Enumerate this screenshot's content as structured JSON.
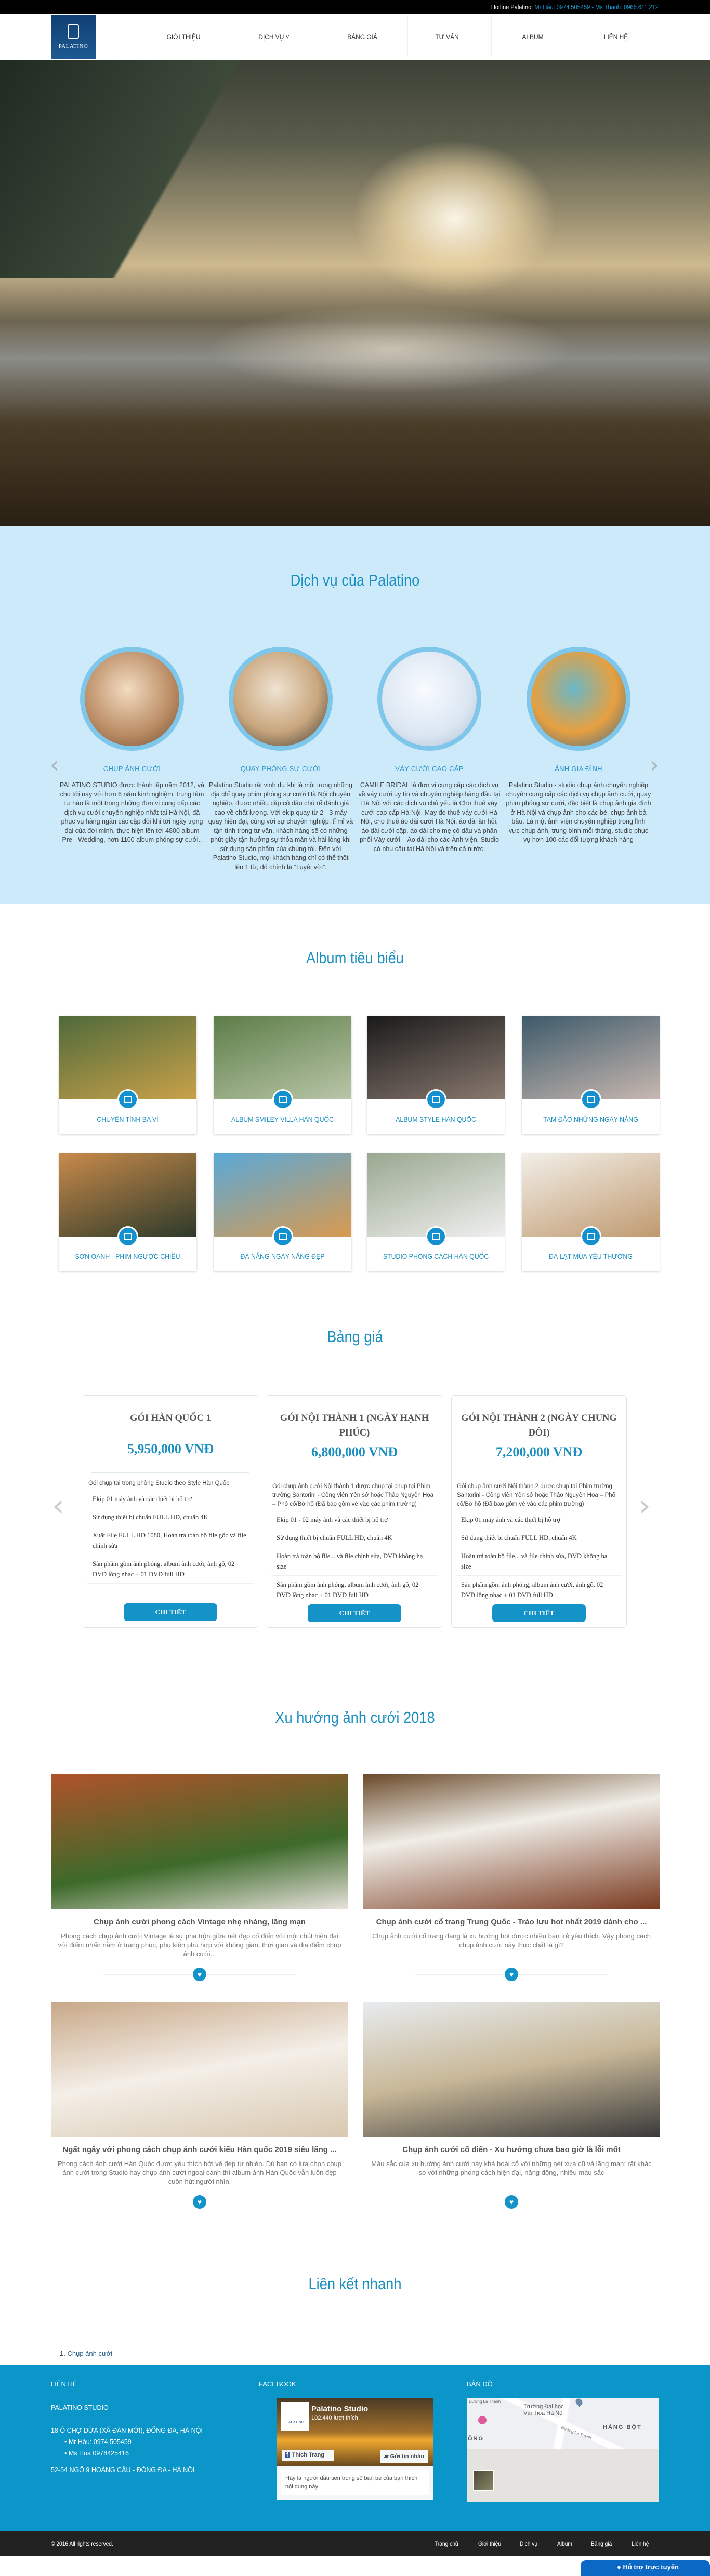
{
  "top_bar": {
    "hotline_label": "Hotline Palatino:",
    "hotline_numbers": "Mr Hậu: 0974.505459 - Ms Thanh: 0966.611.212"
  },
  "header": {
    "logo_text": "PALATINO",
    "nav": [
      "GIỚI THIỆU",
      "DỊCH VỤ ˅",
      "BẢNG GIÁ",
      "TƯ VẤN",
      "ALBUM",
      "LIÊN HỆ"
    ]
  },
  "colors": {
    "primary": "#1b8fc0",
    "footer_bg": "#0a96c8",
    "services_bg": "#cdeafa",
    "bottom_bar": "#222222"
  },
  "services": {
    "title": "Dịch vụ của Palatino",
    "items": [
      {
        "title": "CHỤP ẢNH CƯỚI",
        "text": "PALATINO STUDIO được thành lập năm 2012, và cho tới nay với hơn 6 năm kinh nghiệm, trung tâm tự hào là một trong những đơn vị cung cấp các dịch vụ cưới chuyên nghiệp nhất tại Hà Nội, đã phục vụ hàng ngàn các cặp đôi khi tới ngày trọng đại của đời mình, thực hiện lên tới 4800 album Pre - Wedding, hơn 1100 album phóng sự cưới.."
      },
      {
        "title": "QUAY PHÓNG SỰ CƯỚI",
        "text": "Palatino Studio rất vinh dự khi là một trong những địa chỉ quay phim phóng sự cưới Hà Nội chuyên nghiệp, được nhiều cặp cô dâu chú rể đánh giá cao về chất lượng. Với ekip quay từ 2 - 3 máy quay hiện đại, cùng với sự chuyên nghiệp, tỉ mỉ và tận tình trong tư vấn, khách hàng sẽ có những phút giây tận hưởng sự thỏa mãn và hài lòng khi sử dụng sản phẩm của chúng tôi. Đến với Palatino Studio, mọi khách hàng chỉ có thể thốt lên 1 từ, đó chính là “Tuyệt vời”."
      },
      {
        "title": "VÁY CƯỚI CAO CẤP",
        "text": "CAMILE BRIDAL là đơn vị cung cấp các dịch vụ về váy cưới uy tín và chuyên nghiệp hàng đầu tại Hà Nội với các dịch vụ chủ yếu là Cho thuê váy cưới cao cấp Hà Nội, May đo thuê váy cưới Hà Nội, cho thuê áo dài cưới Hà Nội, áo dài ăn hỏi, áo dài cưới cặp, áo dài cho mẹ cô dâu và phân phối Váy cưới – Áo dài cho các Ảnh viện, Studio có nhu cầu tại Hà Nội và trên cả nước."
      },
      {
        "title": "ẢNH GIA ĐÌNH",
        "text": "Palatino Studio - studio chụp ảnh chuyên nghiệp chuyên cung cấp các dịch vụ chụp ảnh cưới, quay phim phóng sự cưới, đặc biệt là chụp ảnh gia đình ở Hà Nội và chụp ảnh cho các bé, chụp ảnh bà bầu. Là một ảnh viện chuyên nghiệp trong lĩnh vực chụp ảnh, trung bình mỗi tháng, studio phục vụ hơn 100 các đối tượng khách hàng"
      }
    ],
    "prev_icon": "chevron-left",
    "next_icon": "chevron-right"
  },
  "albums": {
    "title": "Album tiêu biểu",
    "items": [
      "CHUYỆN TÌNH BA VÌ",
      "ALBUM SMILEY VILLA HÀN QUỐC",
      "ALBUM STYLE HÀN QUỐC",
      "TAM ĐẢO NHỮNG NGÀY NẮNG",
      "SƠN OANH - PHIM NGƯỢC CHIỀU",
      "ĐÀ NẴNG NGÀY NẮNG ĐẸP",
      "STUDIO PHONG CÁCH HÀN QUỐC",
      "ĐÀ LẠT MÙA YÊU THƯƠNG"
    ]
  },
  "pricing": {
    "title": "Bảng giá",
    "items": [
      {
        "name": "GÓI HÀN QUỐC 1",
        "price": "5,950,000 VNĐ",
        "intro": "Gói chụp tại trong phòng Studio theo Style Hàn Quốc",
        "features": [
          "Ekip 01 máy ảnh và các thiết bị hỗ trợ",
          "Sử dụng thiết bị chuẩn FULL HD, chuẩn 4K",
          "Xuất File FULL HD 1080, Hoàn trả toàn bộ file gốc và file chỉnh sửa",
          "Sản phẩm gồm ảnh phóng, album ảnh cưới, ảnh gỗ, 02 DVD lồng nhạc + 01 DVD full HD"
        ],
        "button": "CHI TIẾT"
      },
      {
        "name": "GÓI NỘI THÀNH 1 (NGÀY HẠNH PHÚC)",
        "price": "6,800,000 VNĐ",
        "intro": "Gói chụp ảnh cưới Nội thành 1 được chụp tại chụp tại Phim trường Santorini - Công viên Yên sở hoặc Thảo Nguyên Hoa – Phố cổ/Bờ hồ (Đã bao gồm vé vào các phim trường)",
        "features": [
          "Ekip 01 - 02 máy ảnh và các thiết bị hỗ trợ",
          "Sử dụng thiết bị chuẩn FULL HD, chuẩn 4K",
          "Hoàn trả toàn bộ file... và file chỉnh sửa, DVD không hạ size",
          "Sản phẩm gồm ảnh phóng, album ảnh cưới, ảnh gỗ, 02 DVD lồng nhạc + 01 DVD full HD"
        ],
        "button": "CHI TIẾT"
      },
      {
        "name": "GÓI NỘI THÀNH 2 (NGÀY CHUNG ĐÔI)",
        "price": "7,200,000 VNĐ",
        "intro": "Gói chụp ảnh cưới Nội thành 2 được chụp tại Phim trường Santorini - Công viên Yên sở hoặc Thảo Nguyên Hoa – Phố cổ/Bờ hồ (Đã bao gồm vé vào các phim trường)",
        "features": [
          "Ekip 01 máy ảnh và các thiết bị hỗ trợ",
          "Sử dụng thiết bị chuẩn FULL HD, chuẩn 4K",
          "Hoàn trả toàn bộ file... và file chỉnh sửa, DVD không hạ size",
          "Sản phẩm gồm ảnh phóng, album ảnh cưới, ảnh gỗ, 02 DVD lồng nhạc + 01 DVD full HD"
        ],
        "button": "CHI TIẾT"
      }
    ]
  },
  "trends": {
    "title": "Xu hướng ảnh cưới 2018",
    "items": [
      {
        "title": "Chụp ảnh cưới phong cách Vintage nhẹ nhàng, lãng mạn",
        "desc": "Phong cách chụp ảnh cưới Vintage là sự pha trộn giữa nét đẹp cổ điển với một chút hiện đại với điểm nhấn nằm ở trang phục, phụ kiện phù hợp với không gian, thời gian và địa điểm chụp ảnh cưới..."
      },
      {
        "title": "Chụp ảnh cưới cổ trang Trung Quốc - Trào lưu hot nhất 2019 dành cho ...",
        "desc": "Chụp ảnh cưới cổ trang đang là xu hướng hot được nhiều bạn trẻ yêu thích. Vậy phong cách chụp ảnh cưới này thực chất là gì?"
      },
      {
        "title": "Ngất ngây với phong cách chụp ảnh cưới kiểu Hàn quốc 2019 siêu lãng ...",
        "desc": "Phong cách ảnh cưới Hàn Quốc được yêu thích bởi vẻ đẹp tự nhiên. Dù bạn có lựa chọn chụp ảnh cưới trong Studio hay chụp ảnh cưới ngoại cảnh thì album ảnh Hàn Quốc vẫn luôn đẹp cuốn hút người nhìn."
      },
      {
        "title": "Chụp ảnh cưới cổ điển - Xu hướng chưa bao giờ là lỗi mốt",
        "desc": "Màu sắc của xu hướng ảnh cưới này khá hoài cổ với những nét xưa cũ và lãng mạn; rất khác so với những phong cách hiện đại, năng động, nhiều màu sắc"
      }
    ]
  },
  "quick_links": {
    "title": "Liên kết nhanh",
    "items": [
      {
        "number": "1.",
        "label": "Chụp ảnh cưới"
      }
    ]
  },
  "footer": {
    "contact": {
      "heading": "LIÊN HỆ",
      "studio": "PALATINO STUDIO",
      "address1": "18 Ô CHỢ DỪA (XÃ ĐÀN MỚI), ĐỐNG ĐA, HÀ NỘI",
      "phones": [
        "Mr Hậu: 0974.505459",
        "Ms Hoa 0978425416"
      ],
      "address2": "52-54 NGÕ 9 HOÀNG CẦU - ĐỐNG ĐA - HÀ NỘI"
    },
    "facebook": {
      "heading": "FACEBOOK",
      "page_name": "Palatino Studio",
      "likes": "102.440 lượt thích",
      "like_button": "Thích Trang",
      "message_button": "Gửi tin nhắn",
      "note": "Hãy là người đầu tiên trong số bạn bè của bạn thích nội dung này",
      "logo_text": "PALATINO"
    },
    "map": {
      "heading": "BẢN ĐỒ",
      "labels": [
        "Đường La Thành",
        "Trường Đại học Văn hóa Hà Nội",
        "HÀNG BỘT",
        "Đường La Thành",
        "ÔNG"
      ]
    }
  },
  "bottom_bar": {
    "copyright": "© 2016 All rights reserved.",
    "links": [
      "Trang chủ",
      "Giới thiệu",
      "Dịch vụ",
      "Album",
      "Bảng giá",
      "Liên hệ"
    ]
  },
  "chat": {
    "label": "Hỗ trợ trực tuyến"
  }
}
